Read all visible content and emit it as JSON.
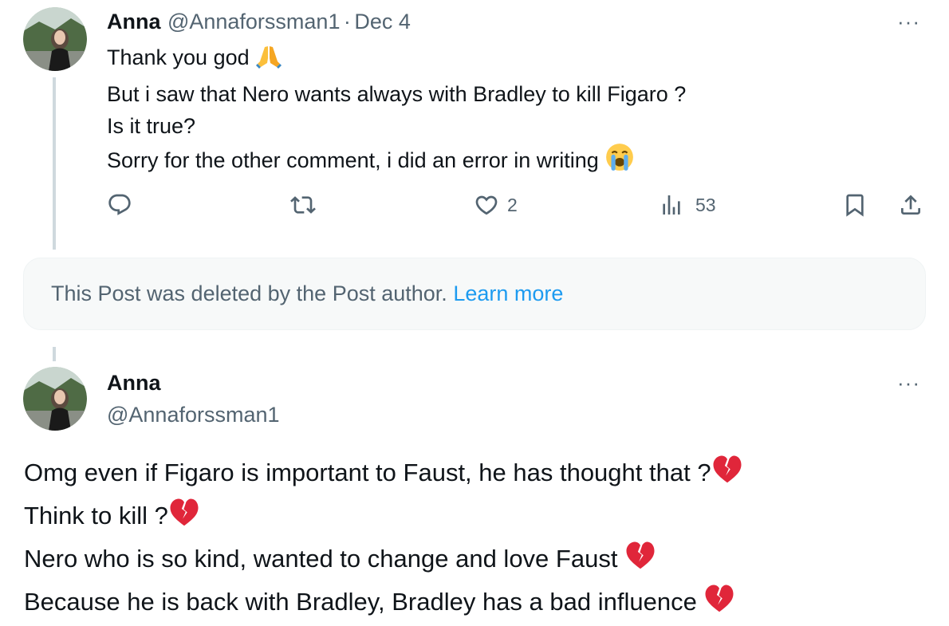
{
  "post1": {
    "display_name": "Anna",
    "handle": "@Annaforssman1",
    "separator": "·",
    "date": "Dec 4",
    "more": "···",
    "lines": [
      "Thank you god",
      "But i saw that Nero wants always with Bradley to kill Figaro ?",
      "Is it true?",
      "Sorry for the other comment, i did an error in writing"
    ],
    "line_emojis": [
      "folded-hands",
      "",
      "",
      "loudly-crying-face"
    ],
    "actions": {
      "reply_icon": "reply-icon",
      "repost_icon": "repost-icon",
      "like_icon": "heart-icon",
      "like_count": "2",
      "views_icon": "views-icon",
      "views_count": "53",
      "bookmark_icon": "bookmark-icon",
      "share_icon": "share-icon"
    }
  },
  "deleted_notice": {
    "text": "This Post was deleted by the Post author.",
    "link": "Learn more"
  },
  "post2": {
    "display_name": "Anna",
    "handle": "@Annaforssman1",
    "more": "···",
    "lines": [
      "Omg even if Figaro is important to Faust, he has thought that ?",
      "Think to kill ?",
      "Nero who is so kind, wanted to change and love Faust ",
      "Because he is back with Bradley, Bradley has a bad influence "
    ],
    "line_emojis": [
      "broken-heart",
      "broken-heart",
      "broken-heart",
      "broken-heart"
    ]
  },
  "colors": {
    "text_primary": "#0f1419",
    "text_secondary": "#536471",
    "link": "#1d9bf0",
    "thread_line": "#cfd9de",
    "broken_heart": "#e0263a"
  }
}
